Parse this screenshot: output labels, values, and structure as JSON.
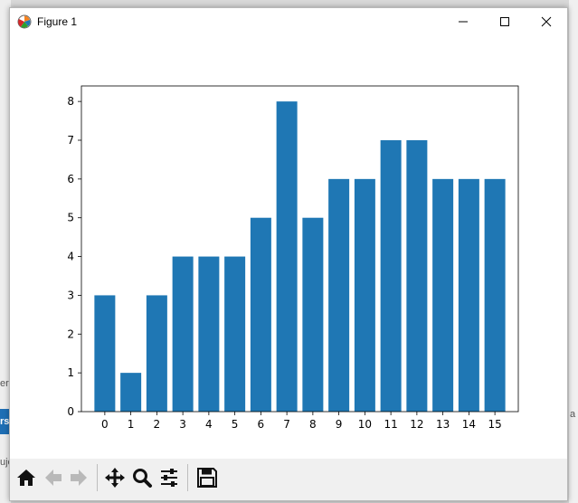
{
  "window": {
    "title": "Figure 1",
    "controls": {
      "minimize": "minimize",
      "maximize": "maximize",
      "close": "close"
    }
  },
  "background": {
    "fragments": [
      "er",
      "rs",
      "uje",
      "a"
    ]
  },
  "toolbar": {
    "buttons": [
      {
        "name": "home",
        "icon": "home-icon",
        "enabled": true
      },
      {
        "name": "back",
        "icon": "back-arrow-icon",
        "enabled": false
      },
      {
        "name": "forward",
        "icon": "forward-arrow-icon",
        "enabled": false
      },
      {
        "name": "pan",
        "icon": "move-icon",
        "enabled": true
      },
      {
        "name": "zoom",
        "icon": "zoom-icon",
        "enabled": true
      },
      {
        "name": "configure",
        "icon": "sliders-icon",
        "enabled": true
      },
      {
        "name": "save",
        "icon": "save-icon",
        "enabled": true
      }
    ]
  },
  "chart_data": {
    "type": "bar",
    "categories": [
      "0",
      "1",
      "2",
      "3",
      "4",
      "5",
      "6",
      "7",
      "8",
      "9",
      "10",
      "11",
      "12",
      "13",
      "14",
      "15"
    ],
    "values": [
      3,
      1,
      3,
      4,
      4,
      4,
      5,
      8,
      5,
      6,
      6,
      7,
      7,
      6,
      6,
      6
    ],
    "yticks": [
      "0",
      "1",
      "2",
      "3",
      "4",
      "5",
      "6",
      "7",
      "8"
    ],
    "ylim": [
      0,
      8.4
    ],
    "title": "",
    "xlabel": "",
    "ylabel": "",
    "grid": false,
    "bar_color": "#1f77b4"
  }
}
